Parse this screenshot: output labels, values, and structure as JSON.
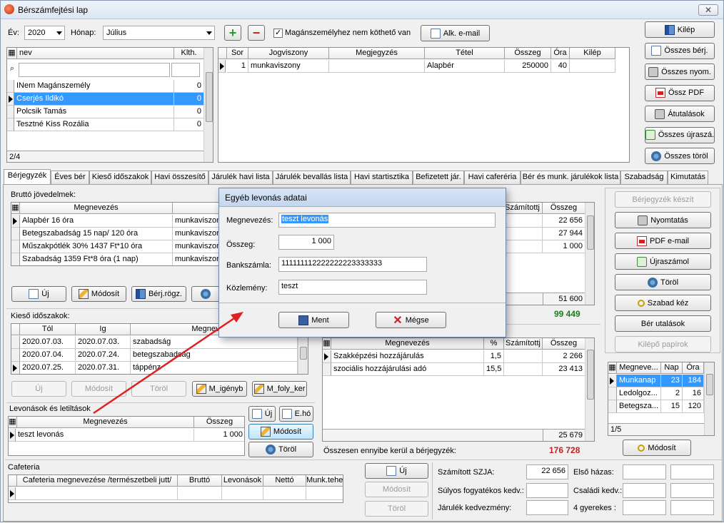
{
  "window": {
    "title": "Bérszámfejtési lap",
    "close_glyph": "✕"
  },
  "top": {
    "year_label": "Év:",
    "year_value": "2020",
    "month_label": "Hónap:",
    "month_value": "Július",
    "add_glyph": "+",
    "remove_glyph": "−",
    "checkbox_label": "Magánszemélyhez nem köthető van",
    "email_btn": "Alk. e-mail"
  },
  "right_buttons": [
    "Kilép",
    "Összes bérj.",
    "Összes nyom.",
    "Össz PDF",
    "Átutalások",
    "Összes újraszá.",
    "Összes töröl"
  ],
  "person_grid": {
    "headers": [
      "nev",
      "Klth."
    ],
    "rows": [
      {
        "name": "INem Magánszemély",
        "klth": "0"
      },
      {
        "name": "Cserjés Ildikó",
        "klth": "0"
      },
      {
        "name": "Polcsik Tamás",
        "klth": "0"
      },
      {
        "name": "Tesztné Kiss Rozália",
        "klth": "0"
      }
    ],
    "footer": "2/4"
  },
  "contract_grid": {
    "headers": [
      "Sor",
      "Jogviszony",
      "Megjegyzés",
      "Tétel",
      "Összeg",
      "Óra",
      "Kilép"
    ],
    "rows": [
      {
        "sor": "1",
        "jogviszony": "munkaviszony",
        "megjegyzes": "",
        "tetel": "Alapbér",
        "osszeg": "250000",
        "ora": "40",
        "kilep": ""
      }
    ]
  },
  "tabs": [
    "Bérjegyzék",
    "Éves bér",
    "Kieső időszakok",
    "Havi összesítő",
    "Járulék havi lista",
    "Járulék bevallás lista",
    "Havi startisztika",
    "Befizetett jár.",
    "Havi caferéria",
    "Bér és munk. járulékok lista",
    "Szabadság",
    "Kimutatás"
  ],
  "gross": {
    "title": "Bruttó jövedelmek:",
    "headers": [
      "Megnevezés",
      "Jogviszony"
    ],
    "rows": [
      {
        "name": "Alapbér 16 óra",
        "jog": "munkaviszony"
      },
      {
        "name": "Betegszabadság 15 nap/ 120 óra",
        "jog": "munkaviszony"
      },
      {
        "name": "Műszakpótlék 30% 1437 Ft*10 óra",
        "jog": "munkaviszony"
      },
      {
        "name": "Szabadság 1359 Ft*8 óra (1 nap)",
        "jog": "munkaviszony"
      }
    ],
    "btn_new": "Új",
    "btn_edit": "Módosít",
    "btn_rogz": "Bérj.rögz."
  },
  "deduct_right": {
    "headers": [
      "Számítottj",
      "Összeg"
    ],
    "values": [
      "22 656",
      "27 944",
      "1 000"
    ],
    "total": "51 600",
    "grand": "99 449"
  },
  "absence": {
    "title": "Kieső időszakok:",
    "headers": [
      "Tól",
      "Ig",
      "Megnevezés"
    ],
    "rows": [
      {
        "tol": "2020.07.03.",
        "ig": "2020.07.03.",
        "name": "szabadság"
      },
      {
        "tol": "2020.07.04.",
        "ig": "2020.07.24.",
        "name": "betegszabadság"
      },
      {
        "tol": "2020.07.25.",
        "ig": "2020.07.31.",
        "name": "táppénz"
      }
    ],
    "btn_new": "Új",
    "btn_edit": "Módosít",
    "btn_del": "Töröl",
    "btn_igeny": "M_igényb",
    "btn_folyk": "M_foly_ker"
  },
  "levonas": {
    "title": "Levonások és letiltások",
    "headers": [
      "Megnevezés",
      "Összeg"
    ],
    "rows": [
      {
        "name": "teszt levonás",
        "osszeg": "1 000"
      }
    ],
    "btn_new": "Új",
    "btn_eho": "E.hó",
    "btn_edit": "Módosít",
    "btn_del": "Töröl"
  },
  "employer": {
    "headers": [
      "Megnevezés",
      "%",
      "Számítottj",
      "Összeg"
    ],
    "rows": [
      {
        "name": "Szakképzési hozzájárulás",
        "pct": "1,5",
        "szam": "",
        "osszeg": "2 266"
      },
      {
        "name": "szociális hozzájárulási adó",
        "pct": "15,5",
        "szam": "",
        "osszeg": "23 413"
      }
    ],
    "total": "25 679",
    "total_label": "Összesen ennyibe kerül a bérjegyzék:",
    "total_value": "176 728"
  },
  "right_panel_buttons": [
    "Bérjegyzék készít",
    "Nyomtatás",
    "PDF e-mail",
    "Újraszámol",
    "Töröl",
    "Szabad kéz",
    "Bér utalások",
    "Kilépő papírok"
  ],
  "worktime": {
    "headers": [
      "Megneve...",
      "Nap",
      "Óra"
    ],
    "rows": [
      {
        "name": "Munkanap",
        "nap": "23",
        "ora": "184"
      },
      {
        "name": "Ledolgoz...",
        "nap": "2",
        "ora": "16"
      },
      {
        "name": "Betegsza...",
        "nap": "15",
        "ora": "120"
      }
    ],
    "footer": "1/5",
    "btn_edit": "Módosít"
  },
  "cafeteria": {
    "title": "Cafeteria",
    "headers": [
      "Cafeteria megnevezése /természetbeli jutt/",
      "Bruttó",
      "Levonások",
      "Nettó",
      "Munk.teher"
    ],
    "btn_new": "Új",
    "btn_edit": "Módosít",
    "btn_del": "Töröl"
  },
  "tax": {
    "szja_label": "Számított SZJA:",
    "szja_value": "22 656",
    "first_marriage_label": "Első házas:",
    "disabled_label": "Súlyos fogyatékos kedv.:",
    "family_label": "Családi kedv.:",
    "jarulek_label": "Járulék kedvezmény:",
    "kids_label": "4 gyerekes :"
  },
  "dialog": {
    "title": "Egyéb levonás adatai",
    "name_label": "Megnevezés:",
    "name_value": "teszt levonás",
    "amount_label": "Összeg:",
    "amount_value": "1 000",
    "bank_label": "Bankszámla:",
    "bank_value": "111111112222222223333333",
    "memo_label": "Közlemény:",
    "memo_value": "teszt",
    "ok_btn": "Ment",
    "cancel_btn": "Mégse"
  },
  "colors": {
    "selection": "#3399ff",
    "grand_total_green": "#1a7f1a",
    "total_red": "#c81e1e",
    "annotation_arrow": "#e02020"
  }
}
